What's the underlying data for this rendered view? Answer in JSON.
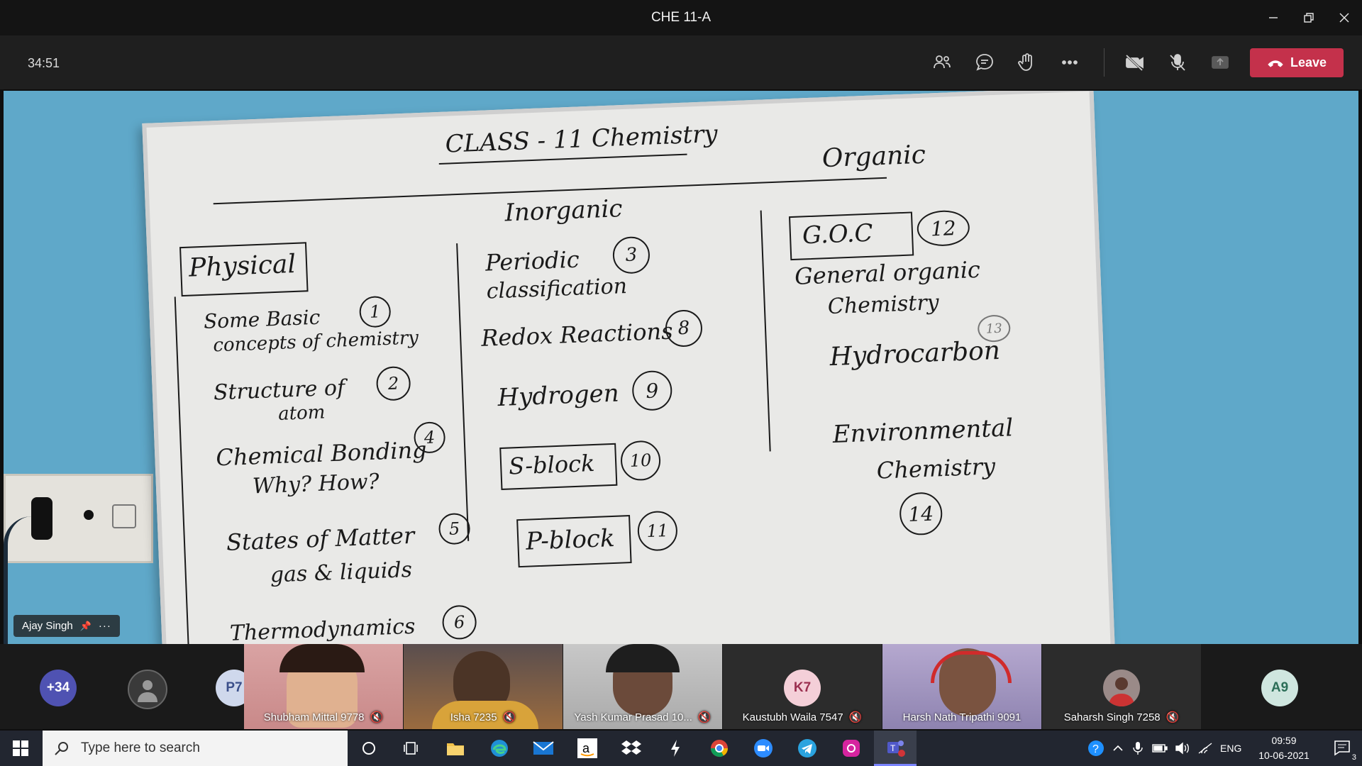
{
  "window": {
    "title": "CHE 11-A"
  },
  "meeting": {
    "timer": "34:51",
    "leave_label": "Leave",
    "speaker_name": "Ajay Singh",
    "participants": [
      {
        "label": "+34",
        "color": "#4f52b2"
      },
      {
        "label": "",
        "color": "#3a3a3a"
      },
      {
        "label": "P7",
        "color": "#cfd8ec",
        "text_color": "#3b4f8a"
      },
      {
        "label": "Shubham Mittal 9778",
        "video": true
      },
      {
        "label": "Isha 7235",
        "video": true
      },
      {
        "label": "Yash Kumar Prasad 10...",
        "video": true
      },
      {
        "label": "Kaustubh Waila 7547",
        "initials": "K7",
        "color": "#f4cfd8",
        "text_color": "#9b3050"
      },
      {
        "label": "Harsh Nath Tripathi 9091",
        "video": true
      },
      {
        "label": "Saharsh Singh 7258",
        "video": true
      },
      {
        "initials": "A9",
        "color": "#cfe6df",
        "text_color": "#2c6e58"
      }
    ]
  },
  "board": {
    "title": "CLASS - 11 Chemistry",
    "inorganic": "Inorganic",
    "organic": "Organic",
    "physical": "Physical",
    "p1": "Some Basic",
    "p1b": "concepts of chemistry",
    "n1": "1",
    "p2": "Structure of",
    "p2b": "atom",
    "n2": "2",
    "p3": "Chemical Bonding",
    "p3b": "Why? How?",
    "n3": "4",
    "p4": "States of Matter",
    "p4b": "gas & liquids",
    "n4": "5",
    "p5": "Thermodynamics",
    "n5": "6",
    "i1": "Periodic",
    "i1b": "classification",
    "in1": "3",
    "i2": "Redox Reactions",
    "in2": "8",
    "i3": "Hydrogen",
    "in3": "9",
    "i4": "S-block",
    "in4": "10",
    "i5": "P-block",
    "in5": "11",
    "o1": "G.O.C",
    "on1": "12",
    "o1b": "General organic",
    "o1c": "Chemistry",
    "o2": "Hydrocarbon",
    "on2": "13",
    "o3": "Environmental",
    "o3b": "Chemistry",
    "on3": "14"
  },
  "taskbar": {
    "search_placeholder": "Type here to search",
    "language": "ENG",
    "time": "09:59",
    "date": "10-06-2021",
    "notifications": "3"
  }
}
